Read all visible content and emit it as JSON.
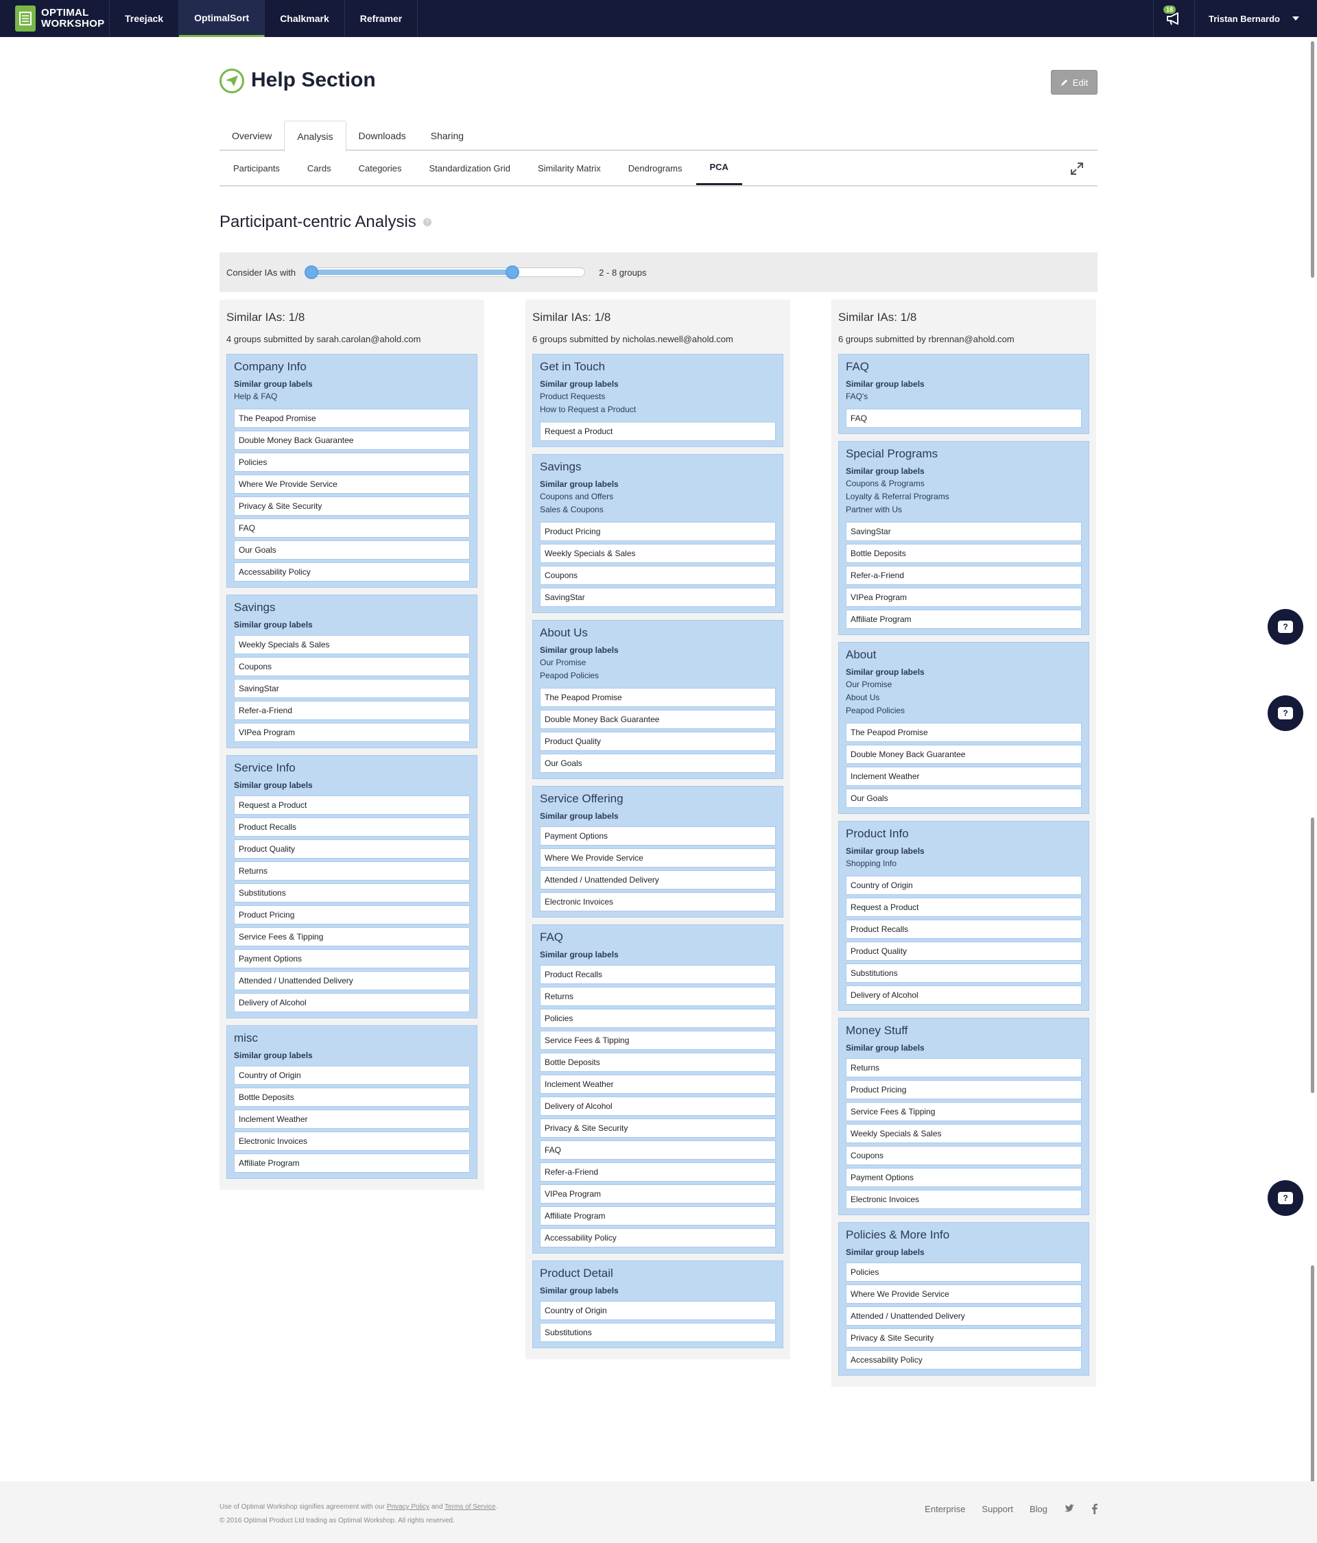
{
  "nav": {
    "logo_line1": "OPTIMAL",
    "logo_line2": "WORKSHOP",
    "items": [
      "Treejack",
      "OptimalSort",
      "Chalkmark",
      "Reframer"
    ],
    "active": "OptimalSort",
    "notification_count": "18",
    "user_name": "Tristan Bernardo"
  },
  "header": {
    "title": "Help Section",
    "edit_label": "Edit"
  },
  "tabs": [
    "Overview",
    "Analysis",
    "Downloads",
    "Sharing"
  ],
  "subtabs": [
    "Participants",
    "Cards",
    "Categories",
    "Standardization Grid",
    "Similarity Matrix",
    "Dendrograms",
    "PCA"
  ],
  "section": {
    "title": "Participant-centric Analysis",
    "help": "?"
  },
  "filter": {
    "label": "Consider IAs with",
    "range_text": "2 - 8 groups",
    "slider_low_fraction": 0.0,
    "slider_high_fraction": 0.75
  },
  "similar_labels_heading": "Similar group labels",
  "columns": [
    {
      "heading": "Similar IAs: 1/8",
      "subtitle": "4 groups submitted by sarah.carolan@ahold.com",
      "groups": [
        {
          "title": "Company Info",
          "labels": [
            "Help & FAQ"
          ],
          "cards": [
            "The Peapod Promise",
            "Double Money Back Guarantee",
            "Policies",
            "Where We Provide Service",
            "Privacy & Site Security",
            "FAQ",
            "Our Goals",
            "Accessability Policy"
          ]
        },
        {
          "title": "Savings",
          "labels": [],
          "cards": [
            "Weekly Specials & Sales",
            "Coupons",
            "SavingStar",
            "Refer-a-Friend",
            "VIPea Program"
          ]
        },
        {
          "title": "Service Info",
          "labels": [],
          "cards": [
            "Request a Product",
            "Product Recalls",
            "Product Quality",
            "Returns",
            "Substitutions",
            "Product Pricing",
            "Service Fees & Tipping",
            "Payment Options",
            "Attended / Unattended Delivery",
            "Delivery of Alcohol"
          ]
        },
        {
          "title": "misc",
          "labels": [],
          "cards": [
            "Country of Origin",
            "Bottle Deposits",
            "Inclement Weather",
            "Electronic Invoices",
            "Affiliate Program"
          ]
        }
      ]
    },
    {
      "heading": "Similar IAs: 1/8",
      "subtitle": "6 groups submitted by nicholas.newell@ahold.com",
      "groups": [
        {
          "title": "Get in Touch",
          "labels": [
            "Product Requests",
            "How to Request a Product"
          ],
          "cards": [
            "Request a Product"
          ]
        },
        {
          "title": "Savings",
          "labels": [
            "Coupons and Offers",
            "Sales & Coupons"
          ],
          "cards": [
            "Product Pricing",
            "Weekly Specials & Sales",
            "Coupons",
            "SavingStar"
          ]
        },
        {
          "title": "About Us",
          "labels": [
            "Our Promise",
            "Peapod Policies"
          ],
          "cards": [
            "The Peapod Promise",
            "Double Money Back Guarantee",
            "Product Quality",
            "Our Goals"
          ]
        },
        {
          "title": "Service Offering",
          "labels": [],
          "cards": [
            "Payment Options",
            "Where We Provide Service",
            "Attended / Unattended Delivery",
            "Electronic Invoices"
          ]
        },
        {
          "title": "FAQ",
          "labels": [],
          "cards": [
            "Product Recalls",
            "Returns",
            "Policies",
            "Service Fees & Tipping",
            "Bottle Deposits",
            "Inclement Weather",
            "Delivery of Alcohol",
            "Privacy & Site Security",
            "FAQ",
            "Refer-a-Friend",
            "VIPea Program",
            "Affiliate Program",
            "Accessability Policy"
          ]
        },
        {
          "title": "Product Detail",
          "labels": [],
          "cards": [
            "Country of Origin",
            "Substitutions"
          ]
        }
      ]
    },
    {
      "heading": "Similar IAs: 1/8",
      "subtitle": "6 groups submitted by rbrennan@ahold.com",
      "groups": [
        {
          "title": "FAQ",
          "labels": [
            "FAQ's"
          ],
          "cards": [
            "FAQ"
          ]
        },
        {
          "title": "Special Programs",
          "labels": [
            "Coupons & Programs",
            "Loyalty & Referral Programs",
            "Partner with Us"
          ],
          "cards": [
            "SavingStar",
            "Bottle Deposits",
            "Refer-a-Friend",
            "VIPea Program",
            "Affiliate Program"
          ]
        },
        {
          "title": "About",
          "labels": [
            "Our Promise",
            "About Us",
            "Peapod Policies"
          ],
          "cards": [
            "The Peapod Promise",
            "Double Money Back Guarantee",
            "Inclement Weather",
            "Our Goals"
          ]
        },
        {
          "title": "Product Info",
          "labels": [
            "Shopping Info"
          ],
          "cards": [
            "Country of Origin",
            "Request a Product",
            "Product Recalls",
            "Product Quality",
            "Substitutions",
            "Delivery of Alcohol"
          ]
        },
        {
          "title": "Money Stuff",
          "labels": [],
          "cards": [
            "Returns",
            "Product Pricing",
            "Service Fees & Tipping",
            "Weekly Specials & Sales",
            "Coupons",
            "Payment Options",
            "Electronic Invoices"
          ]
        },
        {
          "title": "Policies & More Info",
          "labels": [],
          "cards": [
            "Policies",
            "Where We Provide Service",
            "Attended / Unattended Delivery",
            "Privacy & Site Security",
            "Accessability Policy"
          ]
        }
      ]
    }
  ],
  "footer": {
    "legal_prefix": "Use of Optimal Workshop signifies agreement with our",
    "privacy": "Privacy Policy",
    "and": "and",
    "terms": "Terms of Service",
    "period": ".",
    "copyright": "© 2016 Optimal Product Ltd trading as Optimal Workshop. All rights reserved.",
    "links": [
      "Enterprise",
      "Support",
      "Blog"
    ]
  },
  "colors": {
    "nav_bg": "#141a38",
    "accent_green": "#7ab648",
    "group_bg": "#bfd9f3",
    "slider_blue": "#6aaeea"
  }
}
